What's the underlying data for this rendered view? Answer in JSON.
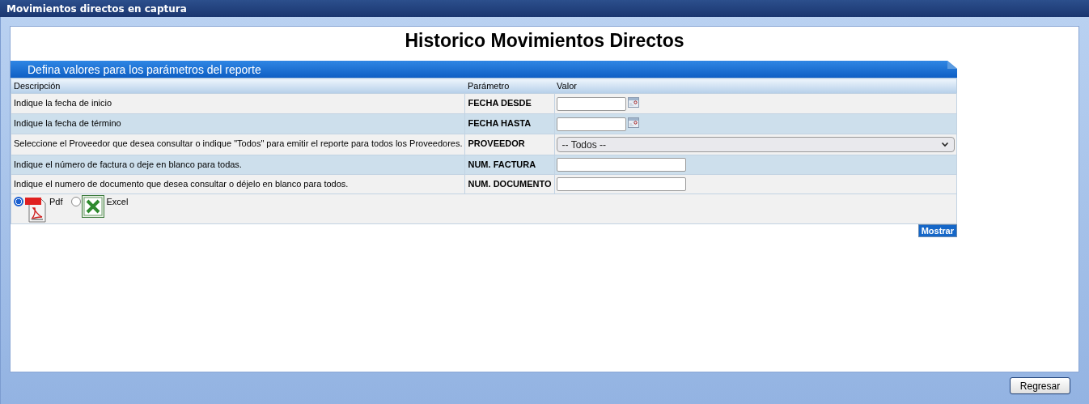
{
  "window": {
    "title": "Movimientos directos en captura"
  },
  "heading": "Historico Movimientos Directos",
  "panel": {
    "title": "Defina valores para los parámetros del reporte",
    "columns": [
      "Descripción",
      "Parámetro",
      "Valor"
    ],
    "rows": [
      {
        "description": "Indique la fecha de inicio",
        "parameter": "FECHA DESDE",
        "kind": "date"
      },
      {
        "description": "Indique la fecha de término",
        "parameter": "FECHA HASTA",
        "kind": "date"
      },
      {
        "description": "Seleccione el Proveedor que desea consultar o indique \"Todos\" para emitir el reporte para todos los Proveedores.",
        "parameter": "PROVEEDOR",
        "kind": "select",
        "value": "-- Todos --"
      },
      {
        "description": "Indique el número de factura o deje en blanco para todas.",
        "parameter": "NUM. FACTURA",
        "kind": "text"
      },
      {
        "description": "Indique el numero de documento que desea consultar o déjelo en blanco para todos.",
        "parameter": "NUM. DOCUMENTO",
        "kind": "text"
      }
    ],
    "formats": [
      {
        "label": "Pdf",
        "kind": "pdf",
        "selected": true
      },
      {
        "label": "Excel",
        "kind": "excel",
        "selected": false
      }
    ],
    "submit": "Mostrar"
  },
  "footer": {
    "button": "Regresar"
  }
}
